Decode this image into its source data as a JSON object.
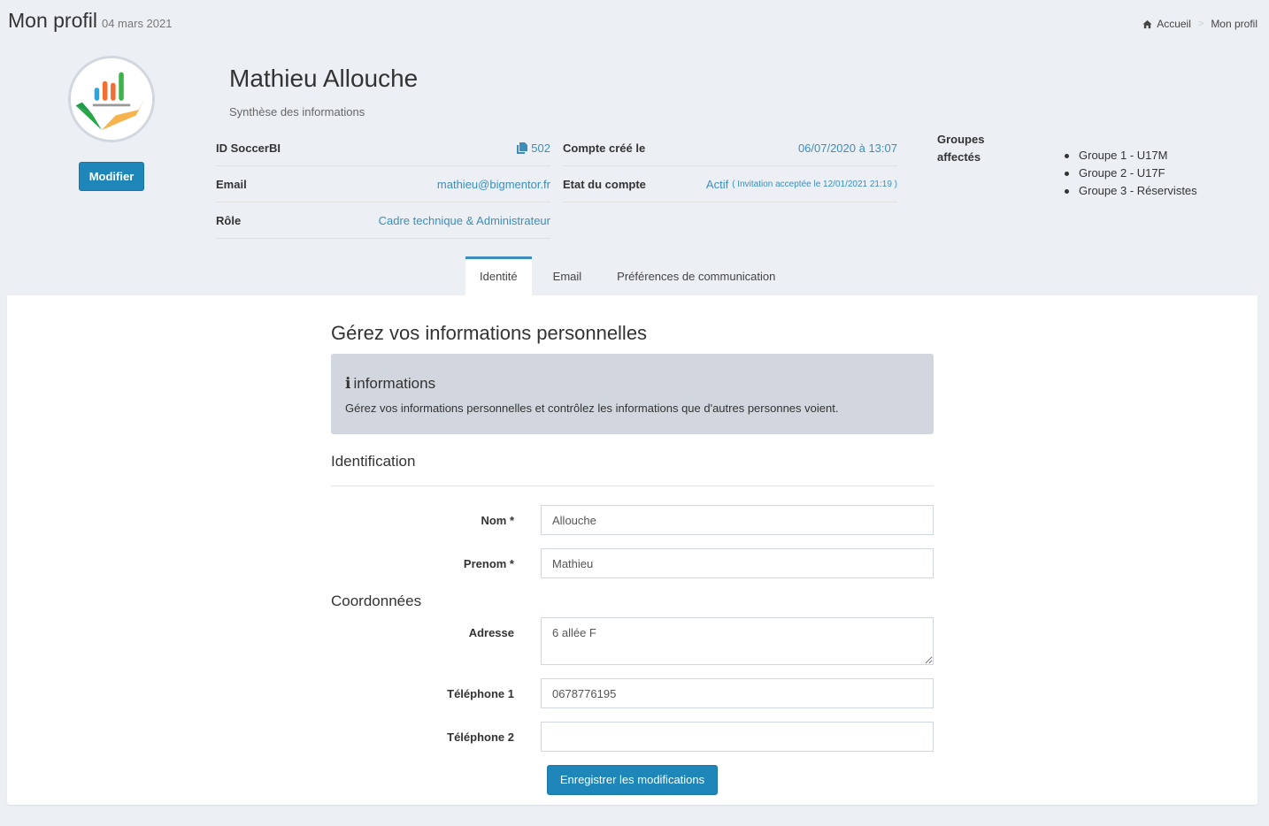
{
  "header": {
    "title": "Mon profil",
    "date": "04 mars 2021"
  },
  "breadcrumb": {
    "home": "Accueil",
    "current": "Mon profil",
    "separator": ">"
  },
  "profile": {
    "name": "Mathieu Allouche",
    "subtitle": "Synthèse des informations",
    "modify_label": "Modifier",
    "left_info": [
      {
        "label": "ID SoccerBI",
        "value": "502"
      },
      {
        "label": "Email",
        "value": "mathieu@bigmentor.fr"
      },
      {
        "label": "Rôle",
        "value": "Cadre technique & Administrateur"
      }
    ],
    "right_info": [
      {
        "label": "Compte créé le",
        "value": "06/07/2020 à 13:07"
      },
      {
        "label": "Etat du compte",
        "value": "Actif",
        "note": "( Invitation acceptée le 12/01/2021 21:19 )"
      }
    ],
    "groups_label": "Groupes affectés",
    "groups": [
      "Groupe 1 - U17M",
      "Groupe 2 - U17F",
      "Groupe 3 - Réservistes"
    ]
  },
  "tabs": [
    "Identité",
    "Email",
    "Préférences de communication"
  ],
  "main": {
    "title": "Gérez vos informations personnelles",
    "callout_title": "informations",
    "callout_text": "Gérez vos informations personnelles et contrôlez les informations que d'autres personnes voient.",
    "identification_title": "Identification",
    "coord_title": "Coordonnées",
    "fields": {
      "nom": {
        "label": "Nom *",
        "value": "Allouche"
      },
      "prenom": {
        "label": "Prenom *",
        "value": "Mathieu"
      },
      "adresse": {
        "label": "Adresse",
        "value": "6 allée F"
      },
      "tel1": {
        "label": "Téléphone 1",
        "value": "0678776195"
      },
      "tel2": {
        "label": "Téléphone 2",
        "value": ""
      }
    },
    "save_label": "Enregistrer les modifications"
  },
  "colors": {
    "accent": "#3c8dbc",
    "button": "#1e86b8",
    "background": "#ecf0f5",
    "callout": "#d2d6de"
  },
  "icons": [
    "home-icon",
    "document-icon",
    "info-icon",
    "logo-chart-icon"
  ]
}
